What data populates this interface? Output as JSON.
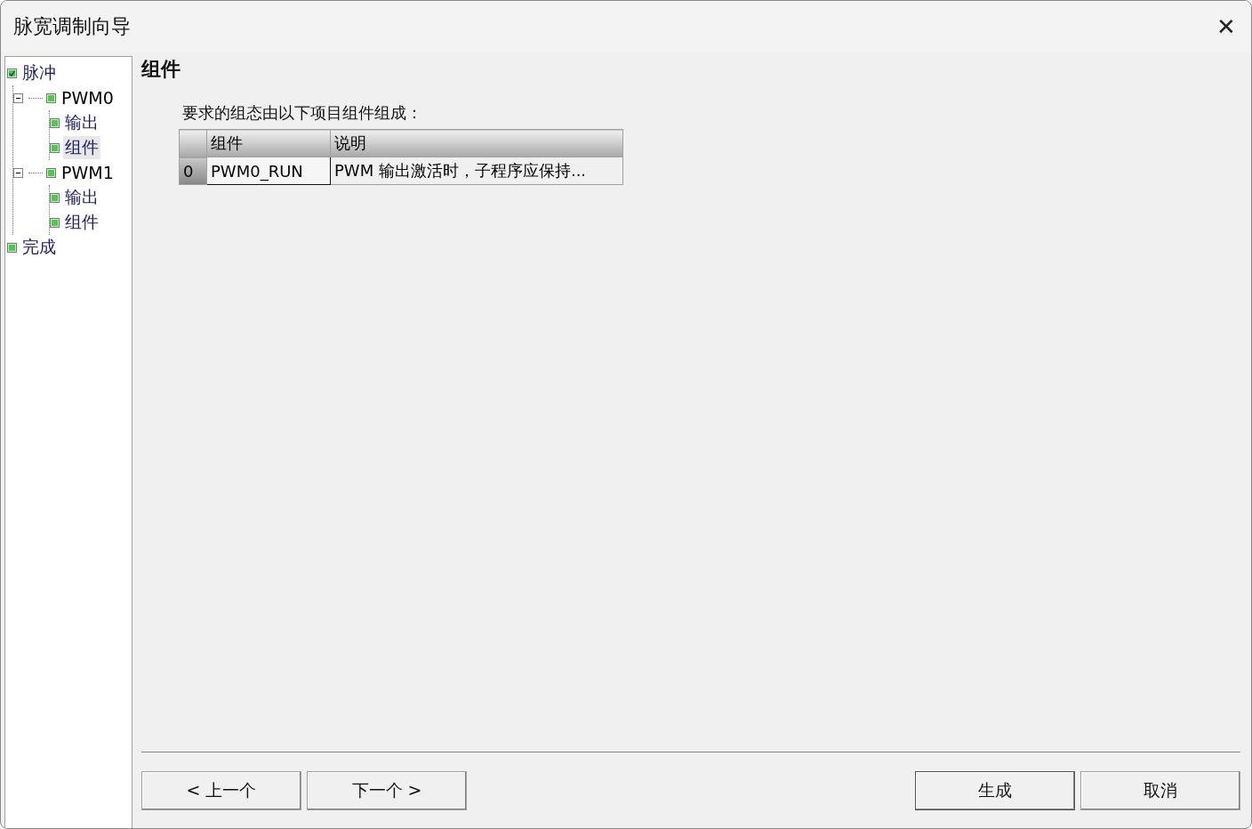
{
  "window": {
    "title": "脉宽调制向导",
    "close": "✕"
  },
  "tree": [
    {
      "label": "脉冲",
      "checked": true,
      "selected": false,
      "children": [
        {
          "label": "PWM0",
          "checked": false,
          "selected": false,
          "expanded": true,
          "children": [
            {
              "label": "输出",
              "checked": false,
              "selected": false
            },
            {
              "label": "组件",
              "checked": false,
              "selected": true
            }
          ]
        },
        {
          "label": "PWM1",
          "checked": false,
          "selected": false,
          "expanded": true,
          "children": [
            {
              "label": "输出",
              "checked": false,
              "selected": false
            },
            {
              "label": "组件",
              "checked": false,
              "selected": false
            }
          ]
        }
      ]
    },
    {
      "label": "完成",
      "checked": false,
      "selected": false
    }
  ],
  "page": {
    "heading": "组件",
    "intro": "要求的组态由以下项目组件组成：",
    "table": {
      "columns": [
        "组件",
        "说明"
      ],
      "rows": [
        {
          "index": "0",
          "cells": [
            {
              "text": "PWM0_RUN",
              "selected": true
            },
            {
              "text": "PWM 输出激活时，子程序应保持...",
              "selected": false
            }
          ]
        }
      ]
    }
  },
  "buttons": [
    {
      "label": "< 上一个",
      "default": false
    },
    {
      "label": "下一个 >",
      "default": false
    },
    {
      "label": "生成",
      "default": true
    },
    {
      "label": "取消",
      "default": false
    }
  ]
}
